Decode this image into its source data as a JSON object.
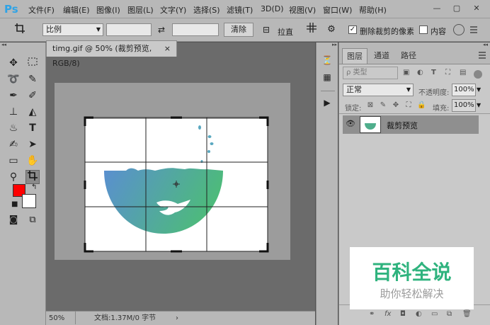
{
  "app": {
    "logo": "Ps"
  },
  "menu": [
    "文件(F)",
    "编辑(E)",
    "图像(I)",
    "图层(L)",
    "文字(Y)",
    "选择(S)",
    "滤镜(T)",
    "3D(D)",
    "视图(V)",
    "窗口(W)",
    "帮助(H)"
  ],
  "window": {
    "minimize": "—",
    "restore": "▢",
    "close": "✕"
  },
  "options": {
    "ratio": "比例",
    "clear": "清除",
    "straighten": "拉直",
    "delete_cropped": "删除裁剪的像素",
    "content_aware": "内容"
  },
  "document": {
    "tab_title": "timg.gif @ 50% (裁剪预览, RGB/8)",
    "tab_close": "×",
    "zoom": "50%",
    "doc_info": "文档:1.37M/0 字节"
  },
  "colors": {
    "foreground": "#ff0000",
    "background": "#ffffff",
    "grad_start": "#5a8fd0",
    "grad_end": "#4dbb7a",
    "accent": "#2fa3e6"
  },
  "layers_panel": {
    "tabs": [
      "图层",
      "通道",
      "路径"
    ],
    "filter_label": "ρ 类型",
    "blend_mode": "正常",
    "opacity_label": "不透明度:",
    "opacity_value": "100%",
    "lock_label": "锁定:",
    "fill_label": "填充:",
    "fill_value": "100%",
    "layer_name": "裁剪预览"
  },
  "watermark": {
    "title": "百科全说",
    "subtitle": "助你轻松解决"
  },
  "icons": [
    "move-icon",
    "marquee-icon",
    "lasso-icon",
    "magic-wand-icon",
    "eyedropper-icon",
    "brush-icon",
    "stamp-icon",
    "eraser-icon",
    "paint-bucket-icon",
    "text-icon",
    "pen-icon",
    "path-select-icon",
    "rectangle-icon",
    "hand-icon",
    "zoom-icon",
    "crop-icon"
  ]
}
